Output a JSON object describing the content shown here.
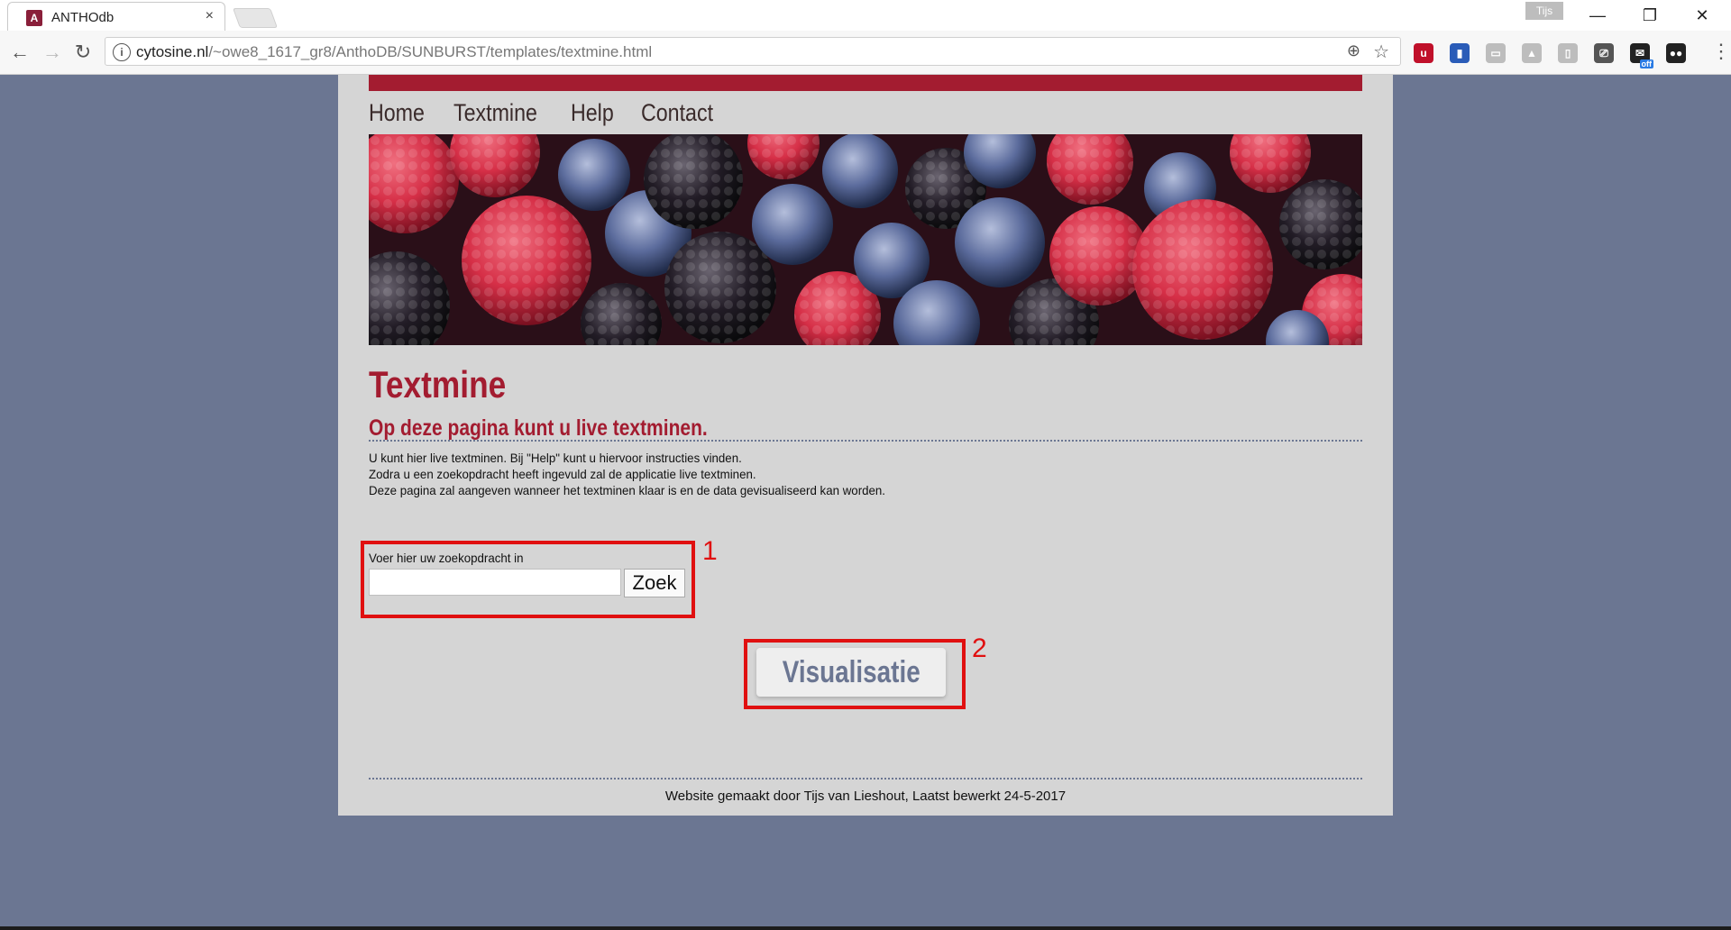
{
  "browser": {
    "tab_title": "ANTHOdb",
    "favicon_letter": "A",
    "close_tab_label": "×",
    "profile_name": "Tijs",
    "window_controls": {
      "minimize": "—",
      "restore": "❐",
      "close": "✕"
    },
    "url_host": "cytosine.nl",
    "url_path": "/~owe8_1617_gr8/AnthoDB/SUNBURST/templates/textmine.html",
    "extensions": [
      {
        "name": "ublock-icon",
        "color": "#c0102a",
        "glyph": "u"
      },
      {
        "name": "book-extension-icon",
        "color": "#2a5cb8",
        "glyph": "▮"
      },
      {
        "name": "extension-grey-1-icon",
        "color": "#bdbdbd",
        "glyph": "▭"
      },
      {
        "name": "drive-icon",
        "color": "#bdbdbd",
        "glyph": "▲"
      },
      {
        "name": "extension-grey-2-icon",
        "color": "#bdbdbd",
        "glyph": "▯"
      },
      {
        "name": "cast-icon",
        "color": "#555555",
        "glyph": "⎚"
      },
      {
        "name": "mail-checker-icon",
        "color": "#222222",
        "glyph": "✉",
        "badge": "off"
      },
      {
        "name": "incognito-icon",
        "color": "#222222",
        "glyph": "●●"
      }
    ]
  },
  "site": {
    "nav": [
      "Home",
      "Textmine",
      "Help",
      "Contact"
    ],
    "heading": "Textmine",
    "subheading": "Op deze pagina kunt u live textminen.",
    "paragraph": [
      "U kunt hier live textminen. Bij \"Help\" kunt u hiervoor instructies vinden.",
      "Zodra u een zoekopdracht heeft ingevuld zal de applicatie live textminen.",
      "Deze pagina zal aangeven wanneer het textminen klaar is en de data gevisualiseerd kan worden."
    ],
    "search_label": "Voer hier uw zoekopdracht in",
    "search_value": "",
    "search_button": "Zoek",
    "visual_button": "Visualisatie",
    "annotation_1": "1",
    "annotation_2": "2",
    "footer": "Website gemaakt door Tijs van Lieshout, Laatst bewerkt 24-5-2017"
  },
  "colors": {
    "background": "#6b7692",
    "accent_red": "#a31c30",
    "annotation_red": "#e01010"
  }
}
